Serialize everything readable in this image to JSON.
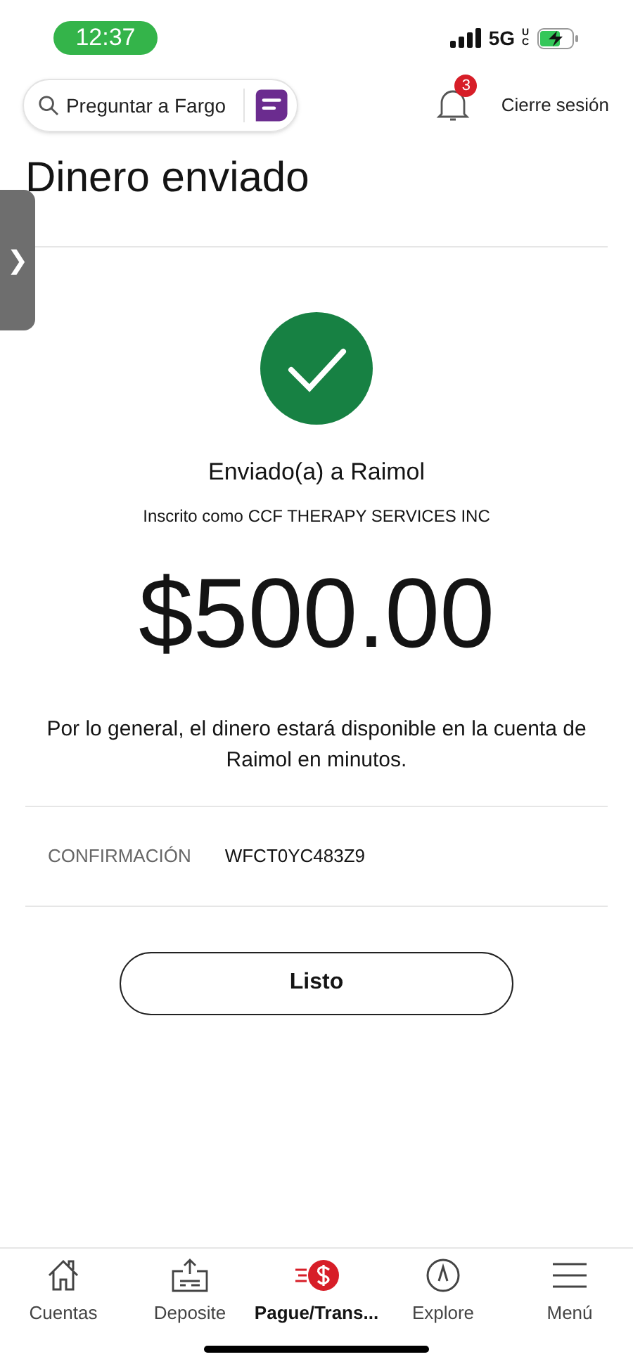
{
  "status_bar": {
    "time": "12:37",
    "network": "5G",
    "network_suffix": "UC"
  },
  "header": {
    "search": {
      "placeholder": "Preguntar a Fargo"
    },
    "notifications": {
      "count": "3"
    },
    "logout": "Cierre sesión"
  },
  "title": "Dinero enviado",
  "confirmation_page": {
    "sent_to": "Enviado(a) a Raimol",
    "enrolled_as": "Inscrito como CCF THERAPY SERVICES INC",
    "amount": "$500.00",
    "note": "Por lo general, el dinero estará disponible en la cuenta de Raimol en minutos.",
    "confirmation_label": "CONFIRMACIÓN",
    "confirmation_number": "WFCT0YC483Z9",
    "done_button": "Listo"
  },
  "side_tab": {
    "label": "❯"
  },
  "tab_bar": [
    {
      "label": "Cuentas",
      "selected": false
    },
    {
      "label": "Deposite",
      "selected": false
    },
    {
      "label": "Pague/Trans...",
      "selected": true
    },
    {
      "label": "Explore",
      "selected": false
    },
    {
      "label": "Menú",
      "selected": false
    }
  ]
}
